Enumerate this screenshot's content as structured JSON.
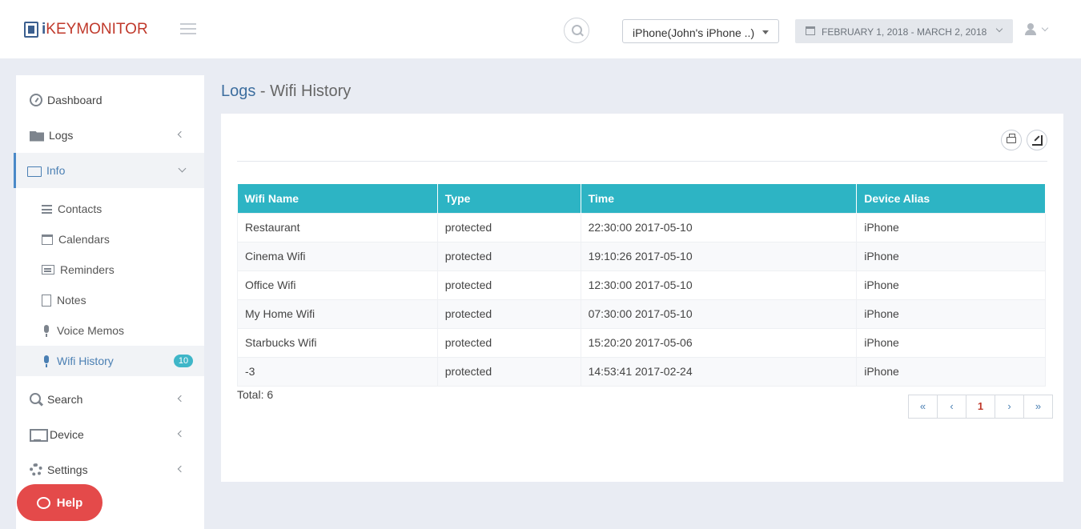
{
  "header": {
    "logo_prefix": "i",
    "logo_key": "KEY",
    "logo_monitor": "MONITOR",
    "device_selector": "iPhone(John's iPhone ..)",
    "date_range": "FEBRUARY 1, 2018 - MARCH 2, 2018"
  },
  "sidebar": {
    "items": [
      {
        "label": "Dashboard",
        "icon": "dashboard-icon"
      },
      {
        "label": "Logs",
        "icon": "folder-icon"
      },
      {
        "label": "Info",
        "icon": "folder-open-icon"
      },
      {
        "label": "Search",
        "icon": "search-icon"
      },
      {
        "label": "Device",
        "icon": "monitor-icon"
      },
      {
        "label": "Settings",
        "icon": "gear-icon"
      }
    ],
    "info_sub": [
      {
        "label": "Contacts",
        "icon": "list-icon"
      },
      {
        "label": "Calendars",
        "icon": "calendar-icon"
      },
      {
        "label": "Reminders",
        "icon": "reminders-icon"
      },
      {
        "label": "Notes",
        "icon": "notes-icon"
      },
      {
        "label": "Voice Memos",
        "icon": "microphone-icon"
      },
      {
        "label": "Wifi History",
        "icon": "microphone-icon",
        "badge": "10"
      }
    ],
    "help_label": "Help"
  },
  "main": {
    "title_crumb": "Logs",
    "title_sep": " - ",
    "title_page": "Wifi History",
    "table": {
      "headers": [
        "Wifi Name",
        "Type",
        "Time",
        "Device Alias"
      ],
      "rows": [
        [
          "Restaurant",
          "protected",
          "22:30:00 2017-05-10",
          "iPhone"
        ],
        [
          "Cinema Wifi",
          "protected",
          "19:10:26 2017-05-10",
          "iPhone"
        ],
        [
          "Office Wifi",
          "protected",
          "12:30:00 2017-05-10",
          "iPhone"
        ],
        [
          "My Home Wifi",
          "protected",
          "07:30:00 2017-05-10",
          "iPhone"
        ],
        [
          "Starbucks Wifi",
          "protected",
          "15:20:20 2017-05-06",
          "iPhone"
        ],
        [
          "-3",
          "protected",
          "14:53:41 2017-02-24",
          "iPhone"
        ]
      ]
    },
    "total": "Total: 6",
    "pagination": [
      "«",
      "‹",
      "1",
      "›",
      "»"
    ],
    "current_page": "1"
  },
  "colors": {
    "accent": "#2db4c4",
    "link": "#3d6e9f",
    "help": "#e44a4a",
    "badge": "#3fb6c8"
  }
}
